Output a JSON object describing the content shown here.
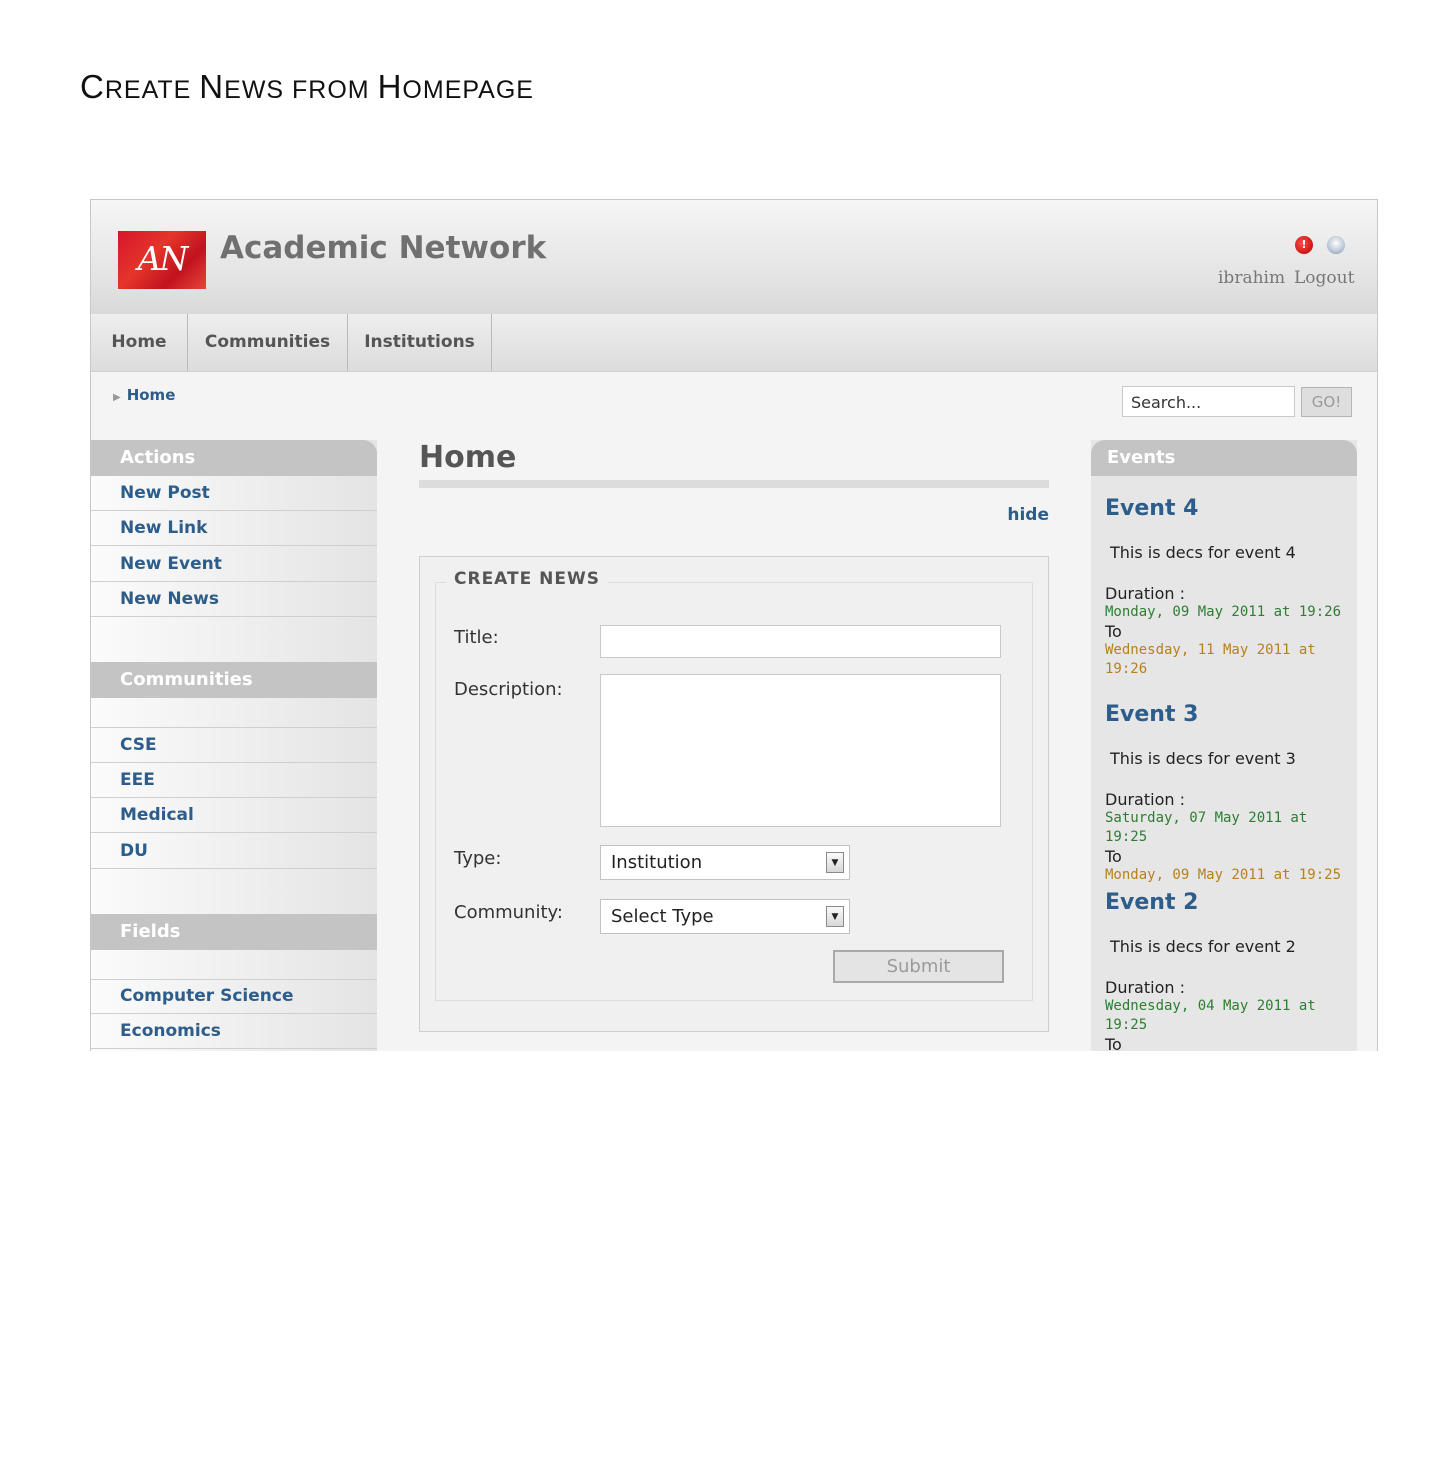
{
  "doc_title": {
    "parts": [
      {
        "big": "C",
        "small": "REATE "
      },
      {
        "big": "N",
        "small": "EWS FROM "
      },
      {
        "big": "H",
        "small": "OMEPAGE"
      }
    ]
  },
  "header": {
    "logo_text": "AN",
    "site_name": "Academic Network",
    "user": "ibrahim",
    "logout": "Logout"
  },
  "nav": {
    "tabs": [
      {
        "label": "Home"
      },
      {
        "label": "Communities"
      },
      {
        "label": "Institutions"
      }
    ]
  },
  "breadcrumb": {
    "current": "Home"
  },
  "search": {
    "placeholder": "Search...",
    "button": "GO!"
  },
  "sidebar": {
    "actions": {
      "title": "Actions",
      "items": [
        {
          "label": "New Post"
        },
        {
          "label": "New Link"
        },
        {
          "label": "New Event"
        },
        {
          "label": "New News"
        }
      ]
    },
    "communities": {
      "title": "Communities",
      "items": [
        {
          "label": "CSE"
        },
        {
          "label": "EEE"
        },
        {
          "label": "Medical"
        },
        {
          "label": "DU"
        }
      ]
    },
    "fields": {
      "title": "Fields",
      "items": [
        {
          "label": "Computer Science"
        },
        {
          "label": "Economics"
        }
      ]
    }
  },
  "main": {
    "title": "Home",
    "hide_link": "hide",
    "form": {
      "legend": "CREATE NEWS",
      "title_label": "Title:",
      "title_value": "",
      "description_label": "Description:",
      "description_value": "",
      "type_label": "Type:",
      "type_value": "Institution",
      "community_label": "Community:",
      "community_value": "Select Type",
      "submit": "Submit"
    }
  },
  "events": {
    "title": "Events",
    "items": [
      {
        "name": "Event 4",
        "desc": "This is decs for event 4",
        "duration_label": "Duration :",
        "start": "Monday, 09 May 2011 at 19:26",
        "to": "To",
        "end": "Wednesday, 11 May 2011 at 19:26"
      },
      {
        "name": "Event 3",
        "desc": "This is decs for event 3",
        "duration_label": "Duration :",
        "start": "Saturday, 07 May 2011 at 19:25",
        "to": "To",
        "end": "Monday, 09 May 2011 at 19:25"
      },
      {
        "name": "Event 2",
        "desc": "This is decs for event 2",
        "duration_label": "Duration :",
        "start": "Wednesday, 04 May 2011 at 19:25",
        "to": "To",
        "end": ""
      }
    ]
  },
  "colors": {
    "link_blue": "#2d5d8a",
    "start_green": "#2e7d32",
    "end_orange": "#b7801f",
    "section_grey": "#c4c4c4",
    "logo_red": "#d8142a"
  }
}
